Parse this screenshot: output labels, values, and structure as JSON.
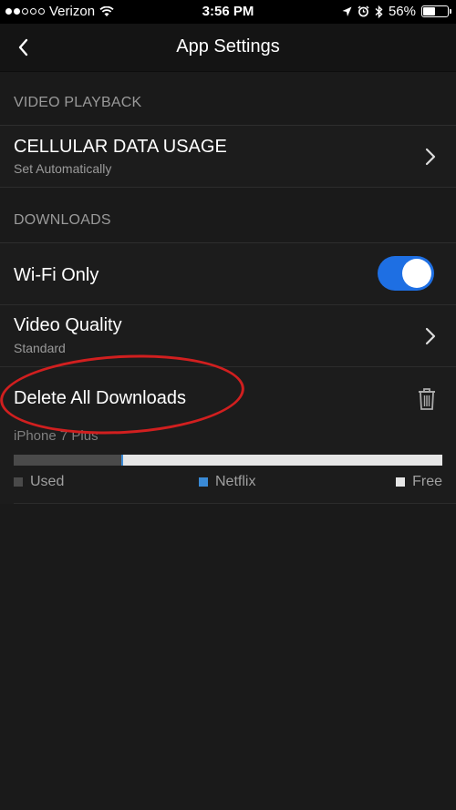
{
  "status_bar": {
    "carrier": "Verizon",
    "time": "3:56 PM",
    "battery": "56%",
    "battery_level": 0.56,
    "signal_bars_filled": 2,
    "signal_bars_total": 5
  },
  "nav": {
    "title": "App Settings",
    "back_icon": "chevron-left-icon"
  },
  "sections": {
    "video_playback": {
      "header": "VIDEO PLAYBACK",
      "cellular": {
        "title": "CELLULAR DATA USAGE",
        "subtitle": "Set Automatically"
      }
    },
    "downloads": {
      "header": "DOWNLOADS",
      "wifi_only": {
        "title": "Wi-Fi Only",
        "enabled": true
      },
      "video_quality": {
        "title": "Video Quality",
        "subtitle": "Standard"
      },
      "delete_all": {
        "title": "Delete All Downloads",
        "icon": "trash-icon"
      },
      "storage": {
        "device": "iPhone 7 Plus",
        "used_fraction": 0.25,
        "netflix_fraction": 0.005,
        "legend": {
          "used": "Used",
          "netflix": "Netflix",
          "free": "Free"
        }
      }
    }
  },
  "colors": {
    "toggle_on": "#1e6fe3",
    "netflix": "#3a8ad6",
    "used": "#4a4a4a",
    "free": "#e6e6e6",
    "annotation": "#d11f1f"
  }
}
